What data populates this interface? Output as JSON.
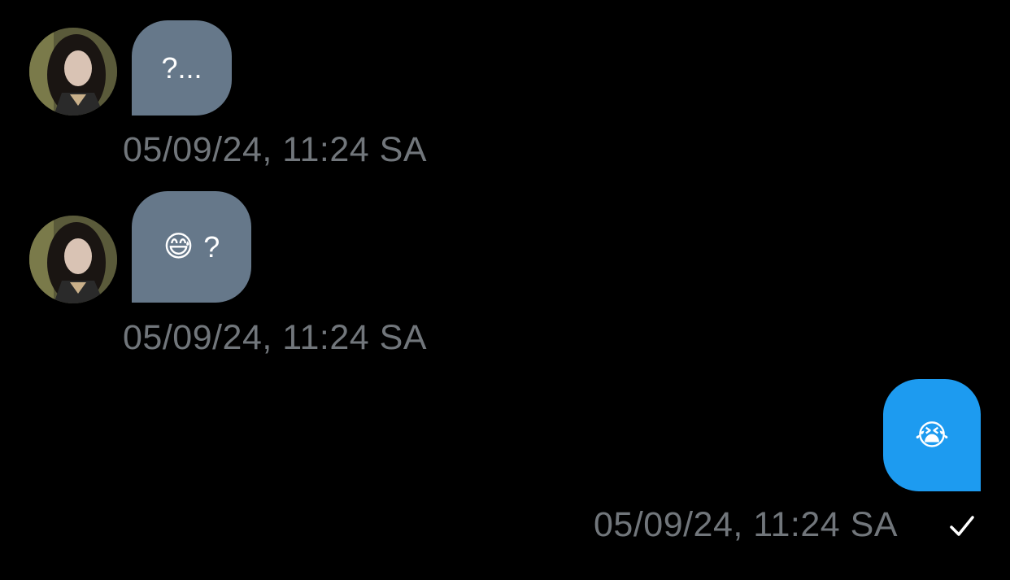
{
  "messages": [
    {
      "direction": "incoming",
      "text": "?...",
      "timestamp": "05/09/24, 11:24 SA",
      "avatar_icon": "user-avatar"
    },
    {
      "direction": "incoming",
      "emoji": "😅",
      "text": "?",
      "emoji_icon": "grinning-sweat-emoji",
      "timestamp": "05/09/24, 11:24 SA",
      "avatar_icon": "user-avatar"
    },
    {
      "direction": "outgoing",
      "emoji": "😭",
      "emoji_icon": "loudly-crying-emoji",
      "timestamp": "05/09/24, 11:24 SA",
      "status_icon": "check-icon"
    }
  ],
  "colors": {
    "background": "#000000",
    "incoming_bubble": "#66788a",
    "outgoing_bubble": "#1d9bf0",
    "timestamp": "#71767b"
  }
}
